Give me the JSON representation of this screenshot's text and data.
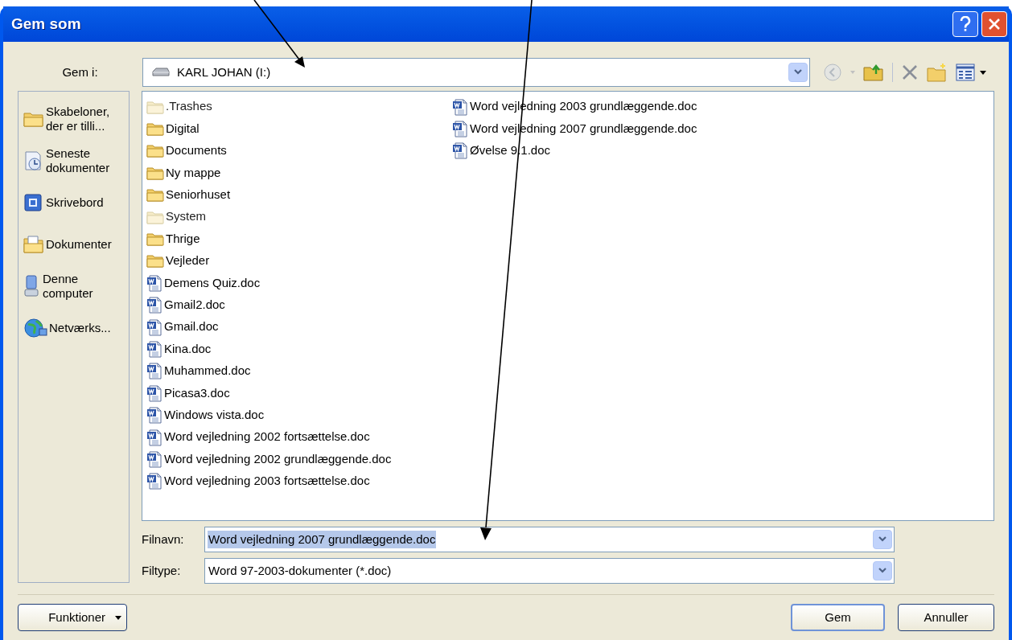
{
  "window": {
    "title": "Gem som"
  },
  "location": {
    "label": "Gem i:",
    "value": "KARL JOHAN (I:)"
  },
  "sidebar": {
    "items": [
      {
        "kind": "templates",
        "label": "Skabeloner, der er tilli..."
      },
      {
        "kind": "recent",
        "label": "Seneste dokumenter"
      },
      {
        "kind": "desktop",
        "label": "Skrivebord"
      },
      {
        "kind": "documents",
        "label": "Dokumenter"
      },
      {
        "kind": "computer",
        "label": "Denne computer"
      },
      {
        "kind": "network",
        "label": "Netværks..."
      }
    ]
  },
  "files": [
    {
      "kind": "folder",
      "hidden": true,
      "name": ".Trashes"
    },
    {
      "kind": "folder",
      "hidden": false,
      "name": "Digital"
    },
    {
      "kind": "folder",
      "hidden": false,
      "name": "Documents"
    },
    {
      "kind": "folder",
      "hidden": false,
      "name": "Ny mappe"
    },
    {
      "kind": "folder",
      "hidden": false,
      "name": "Seniorhuset"
    },
    {
      "kind": "folder",
      "hidden": true,
      "name": "System"
    },
    {
      "kind": "folder",
      "hidden": false,
      "name": "Thrige"
    },
    {
      "kind": "folder",
      "hidden": false,
      "name": "Vejleder"
    },
    {
      "kind": "doc",
      "hidden": false,
      "name": "Demens Quiz.doc"
    },
    {
      "kind": "doc",
      "hidden": false,
      "name": "Gmail2.doc"
    },
    {
      "kind": "doc",
      "hidden": false,
      "name": "Gmail.doc"
    },
    {
      "kind": "doc",
      "hidden": false,
      "name": "Kina.doc"
    },
    {
      "kind": "doc",
      "hidden": false,
      "name": "Muhammed.doc"
    },
    {
      "kind": "doc",
      "hidden": false,
      "name": "Picasa3.doc"
    },
    {
      "kind": "doc",
      "hidden": false,
      "name": "Windows vista.doc"
    },
    {
      "kind": "doc",
      "hidden": false,
      "name": "Word vejledning 2002 fortsættelse.doc"
    },
    {
      "kind": "doc",
      "hidden": false,
      "name": "Word vejledning 2002 grundlæggende.doc"
    },
    {
      "kind": "doc",
      "hidden": false,
      "name": "Word vejledning 2003 fortsættelse.doc"
    },
    {
      "kind": "doc",
      "hidden": false,
      "name": "Word vejledning 2003 grundlæggende.doc"
    },
    {
      "kind": "doc",
      "hidden": false,
      "name": "Word vejledning 2007 grundlæggende.doc"
    },
    {
      "kind": "doc",
      "hidden": false,
      "name": "Øvelse 9.1.doc"
    }
  ],
  "filename": {
    "label": "Filnavn:",
    "value": "Word vejledning 2007 grundlæggende.doc",
    "text_selected": true
  },
  "filetype": {
    "label": "Filtype:",
    "value": "Word 97-2003-dokumenter (*.doc)"
  },
  "buttons": {
    "tools": "Funktioner",
    "save": "Gem",
    "cancel": "Annuller"
  }
}
